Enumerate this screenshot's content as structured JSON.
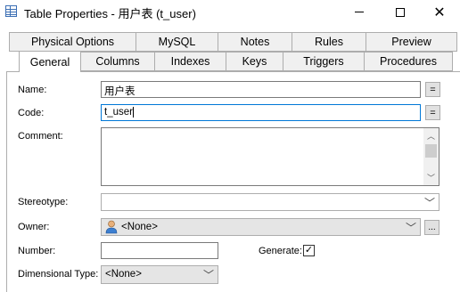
{
  "window": {
    "title": "Table Properties - 用户表 (t_user)",
    "controls": {
      "close_glyph": "✕"
    }
  },
  "tabs": {
    "back_row": [
      "Physical Options",
      "MySQL",
      "Notes",
      "Rules",
      "Preview"
    ],
    "front_row": [
      "General",
      "Columns",
      "Indexes",
      "Keys",
      "Triggers",
      "Procedures"
    ],
    "active": "General"
  },
  "form": {
    "name": {
      "label": "Name:",
      "value": "用户表",
      "button": "="
    },
    "code": {
      "label": "Code:",
      "value": "t_user",
      "button": "="
    },
    "comment": {
      "label": "Comment:",
      "value": ""
    },
    "stereotype": {
      "label": "Stereotype:",
      "value": ""
    },
    "owner": {
      "label": "Owner:",
      "value": "<None>",
      "button": "...",
      "icon": "user-icon"
    },
    "number": {
      "label": "Number:",
      "value": ""
    },
    "generate": {
      "label": "Generate:",
      "checked": true,
      "mark": "✓"
    },
    "dimensional_type": {
      "label": "Dimensional Type:",
      "value": "<None>"
    }
  },
  "colors": {
    "focus_border": "#0078d7",
    "tab_border": "#adadad",
    "tab_bg": "#f0f0f0"
  }
}
